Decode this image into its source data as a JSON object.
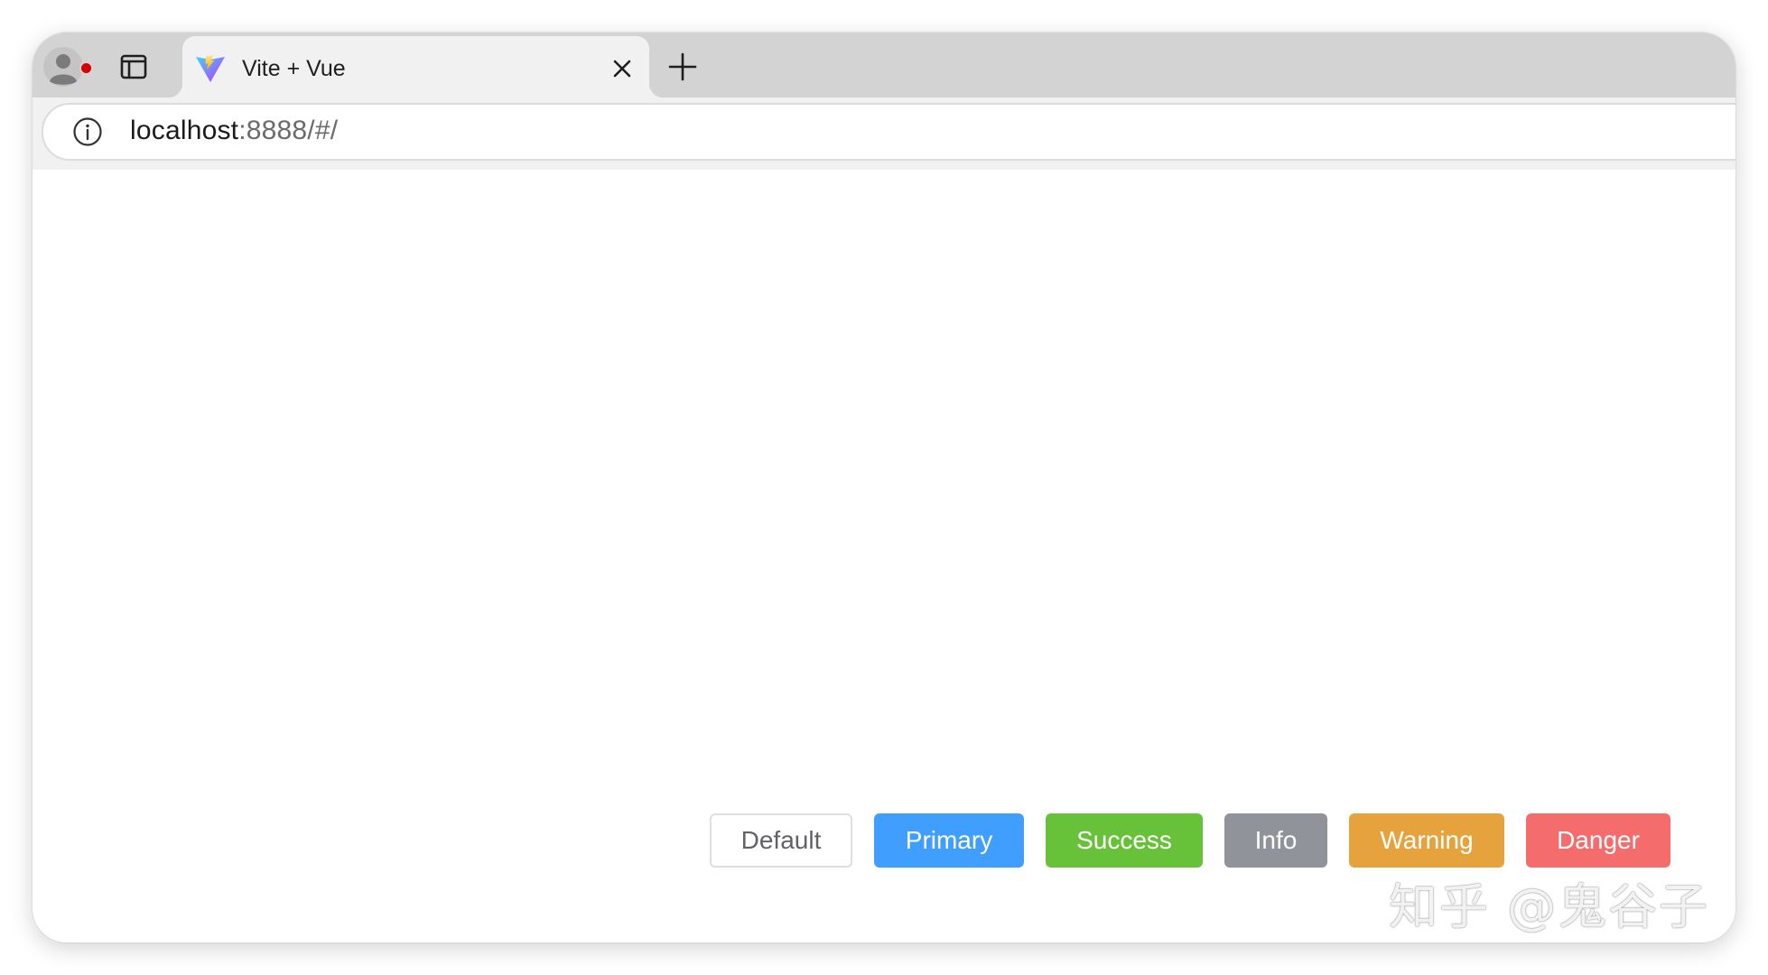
{
  "browser": {
    "tab": {
      "title": "Vite + Vue",
      "favicon": "vite-logo-icon"
    },
    "address_bar": {
      "host": "localhost",
      "path": ":8888/#/"
    },
    "icons": {
      "profile": "profile-avatar-icon",
      "sidebar": "sidebar-toggle-icon",
      "close": "close-icon",
      "new_tab": "plus-icon",
      "site_info": "info-icon"
    }
  },
  "buttons": [
    {
      "label": "Default",
      "type": "default",
      "color": "#ffffff"
    },
    {
      "label": "Primary",
      "type": "primary",
      "color": "#409eff"
    },
    {
      "label": "Success",
      "type": "success",
      "color": "#67c23a"
    },
    {
      "label": "Info",
      "type": "info",
      "color": "#909399"
    },
    {
      "label": "Warning",
      "type": "warning",
      "color": "#e6a23c"
    },
    {
      "label": "Danger",
      "type": "danger",
      "color": "#f56c6c"
    }
  ],
  "watermark": "知乎 @鬼谷子"
}
